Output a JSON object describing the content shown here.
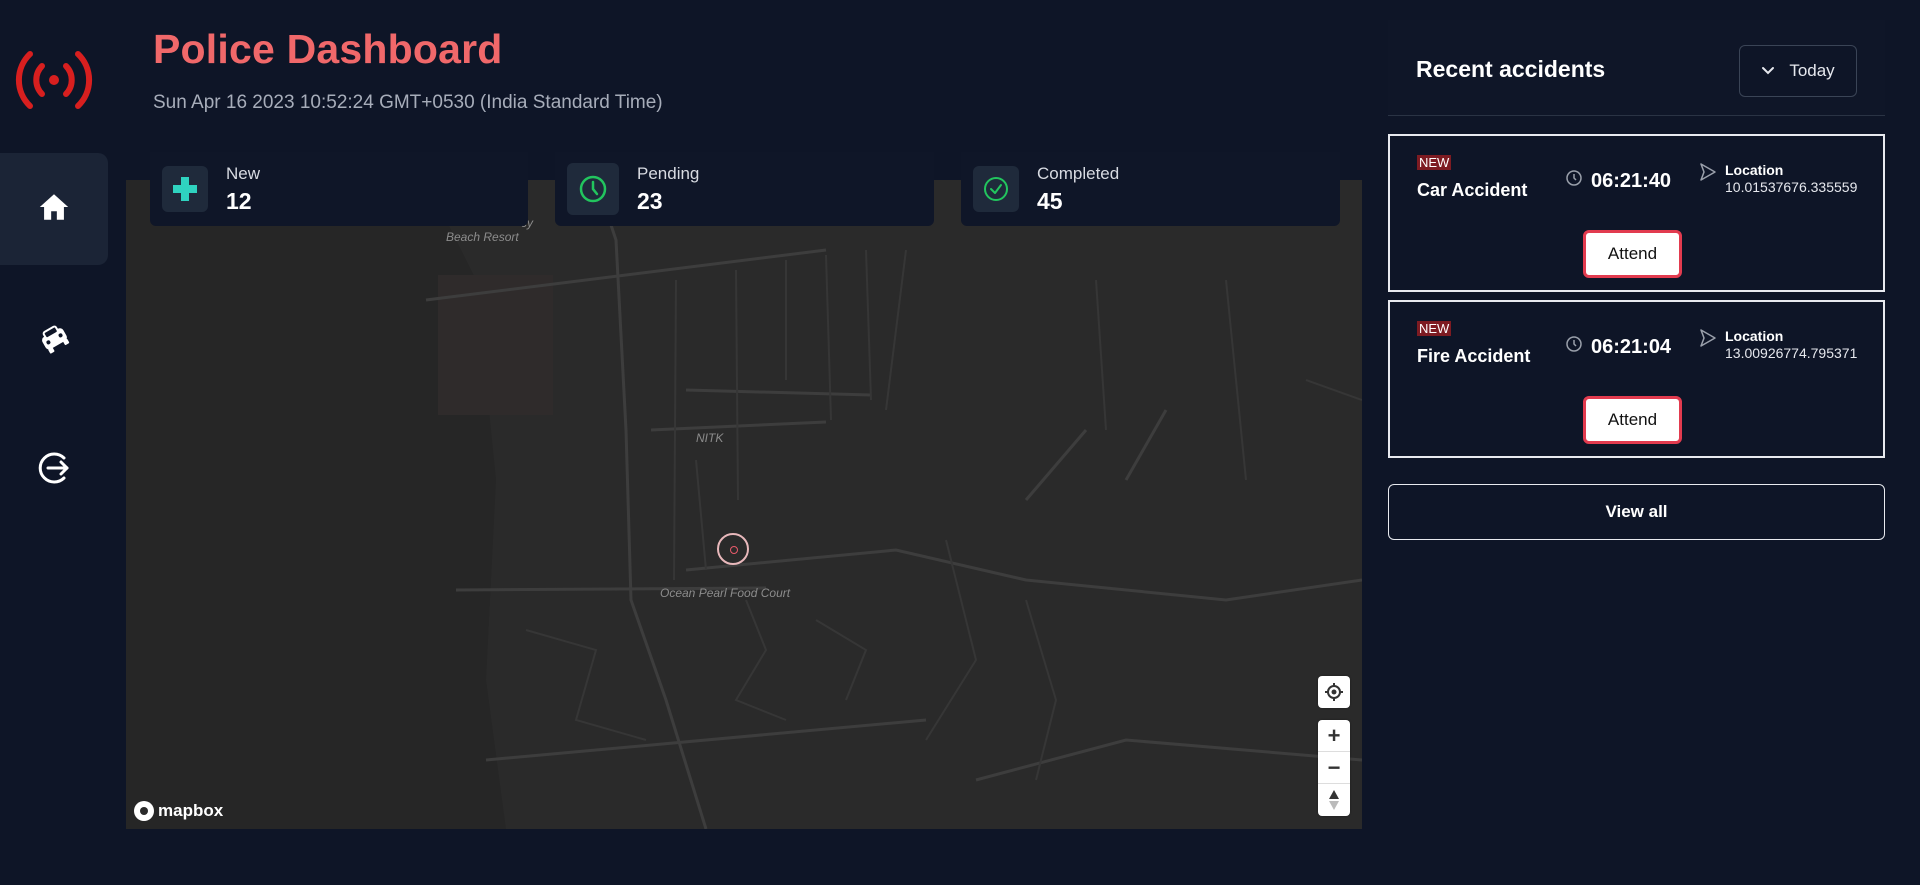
{
  "app": {
    "title": "Police Dashboard",
    "datetime": "Sun Apr 16 2023 10:52:24 GMT+0530 (India Standard Time)",
    "accent_color": "#f0686a"
  },
  "sidebar": {
    "logo_icon": "broadcast-signal-icon",
    "items": [
      {
        "name": "home",
        "icon": "home-icon",
        "active": true
      },
      {
        "name": "accidents",
        "icon": "car-crash-icon",
        "active": false
      },
      {
        "name": "logout",
        "icon": "logout-icon",
        "active": false
      }
    ]
  },
  "stats": [
    {
      "label": "New",
      "value": "12",
      "icon": "medical-cross-icon",
      "color": "#2fd3c0"
    },
    {
      "label": "Pending",
      "value": "23",
      "icon": "clock-icon",
      "color": "#22c55e"
    },
    {
      "label": "Completed",
      "value": "45",
      "icon": "check-circle-icon",
      "color": "#22c55e"
    }
  ],
  "map": {
    "labels": [
      "Beach Resort",
      "cy",
      "NITK",
      "Ocean Pearl Food Court"
    ],
    "attribution": "mapbox",
    "controls": [
      "locate",
      "zoom-in",
      "zoom-out",
      "compass"
    ]
  },
  "panel": {
    "title": "Recent accidents",
    "filter_label": "Today",
    "accidents": [
      {
        "badge": "NEW",
        "type": "Car Accident",
        "time": "06:21:40",
        "location_label": "Location",
        "location": "10.01537676.335559",
        "action": "Attend"
      },
      {
        "badge": "NEW",
        "type": "Fire Accident",
        "time": "06:21:04",
        "location_label": "Location",
        "location": "13.00926774.795371",
        "action": "Attend"
      }
    ],
    "view_all": "View all"
  }
}
